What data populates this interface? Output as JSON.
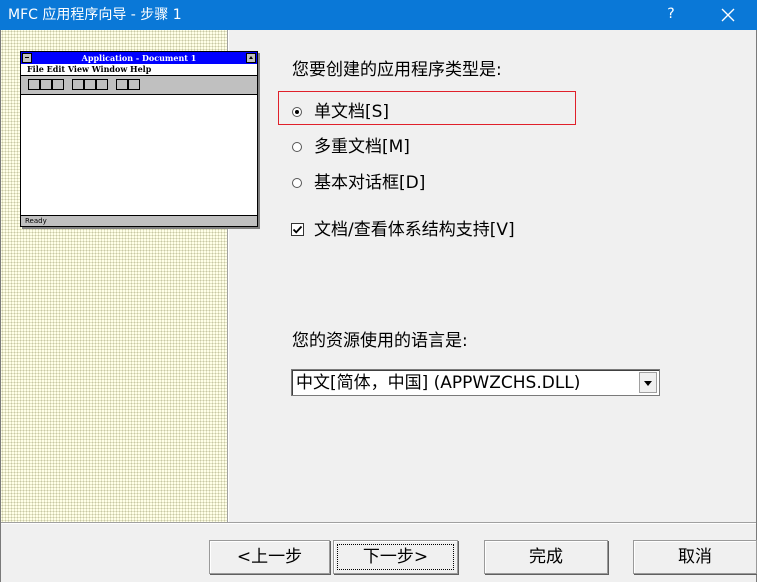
{
  "window": {
    "title": "MFC 应用程序向导 - 步骤 1",
    "help": "?",
    "accent_color": "#0a78d7"
  },
  "illustration": {
    "app_title": "Application - Document 1",
    "menu": "File  Edit  View  Window  Help",
    "status": "Ready"
  },
  "main": {
    "app_type_question": "您要创建的应用程序类型是:",
    "options": [
      {
        "label": "单文档[S]",
        "checked": true
      },
      {
        "label": "多重文档[M]",
        "checked": false
      },
      {
        "label": "基本对话框[D]",
        "checked": false
      }
    ],
    "doc_view_label": "文档/查看体系结构支持[V]",
    "doc_view_checked": true,
    "language_question": "您的资源使用的语言是:",
    "language_value": "中文[简体，中国] (APPWZCHS.DLL)"
  },
  "buttons": {
    "back": "<上一步",
    "next": "下一步>",
    "finish": "完成",
    "cancel": "取消"
  }
}
